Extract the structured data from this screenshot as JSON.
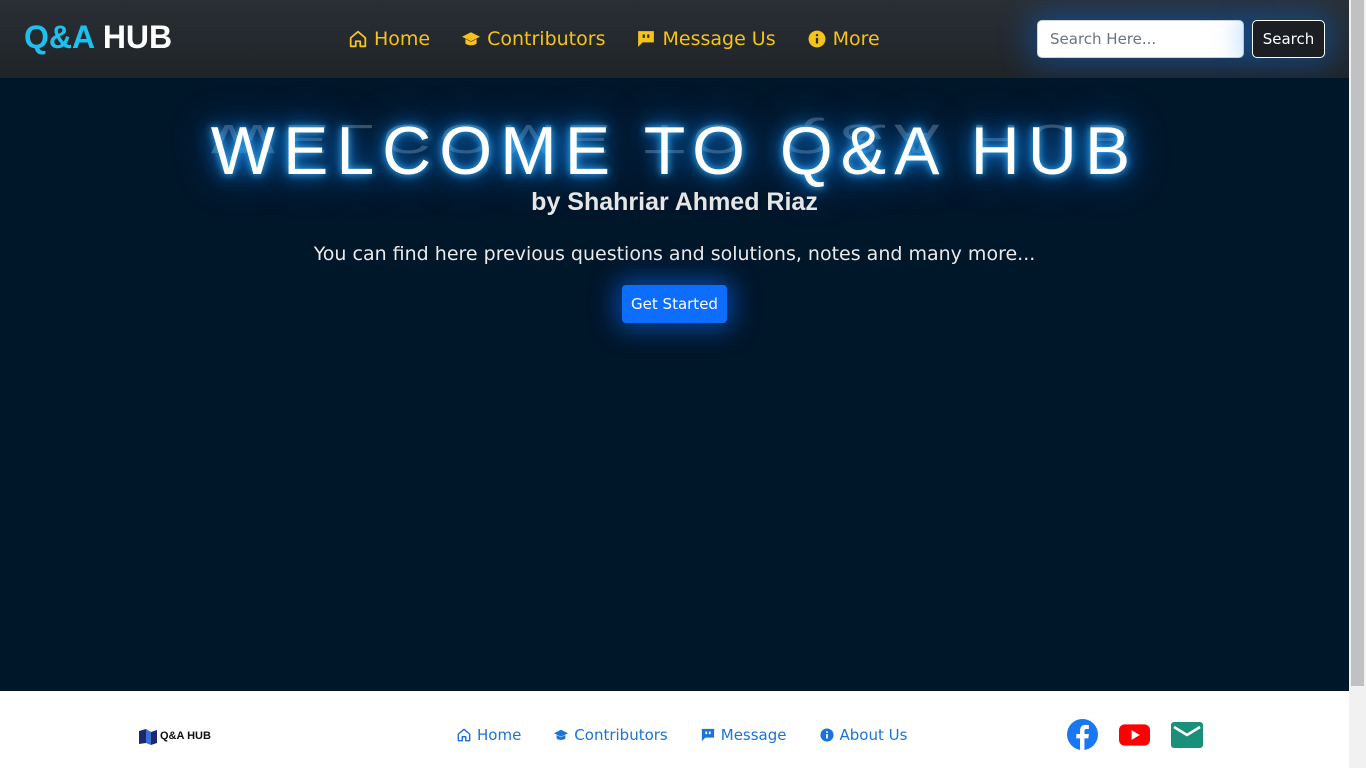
{
  "navbar": {
    "brand_part1": "Q&A",
    "brand_part2": "HUB",
    "links": [
      {
        "label": "Home",
        "icon": "home-icon"
      },
      {
        "label": "Contributors",
        "icon": "graduation-cap-icon"
      },
      {
        "label": "Message Us",
        "icon": "message-icon"
      },
      {
        "label": "More",
        "icon": "info-icon"
      }
    ],
    "search": {
      "placeholder": "Search Here...",
      "value": "",
      "button_label": "Search"
    },
    "link_color": "#f7c21a",
    "brand_accent": "#1ec0f0"
  },
  "hero": {
    "title": "WELCOME TO Q&A HUB",
    "subtitle": "by Shahriar Ahmed Riaz",
    "description": "You can find here previous questions and solutions, notes and many more...",
    "button_label": "Get Started",
    "button_color": "#0d6efd",
    "background": "#001629"
  },
  "footer": {
    "logo_text": "Q&A HUB",
    "links": [
      {
        "label": "Home",
        "icon": "home-icon"
      },
      {
        "label": "Contributors",
        "icon": "graduation-cap-icon"
      },
      {
        "label": "Message",
        "icon": "message-icon"
      },
      {
        "label": "About Us",
        "icon": "info-icon"
      }
    ],
    "social": [
      {
        "name": "facebook-icon",
        "color": "#1877f2"
      },
      {
        "name": "youtube-icon",
        "color": "#ff0000"
      },
      {
        "name": "email-icon",
        "color": "#1a8f7a"
      }
    ],
    "link_color": "#1a73d9"
  }
}
